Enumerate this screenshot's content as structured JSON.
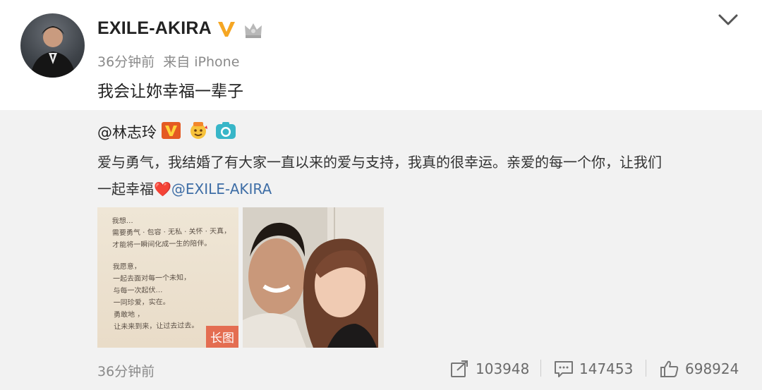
{
  "header": {
    "username": "EXILE-AKIRA",
    "time": "36分钟前",
    "source": "来自 iPhone",
    "post_text": "我会让妳幸福一辈子"
  },
  "repost": {
    "user": "@林志玲",
    "text_line1": "爱与勇气，我结婚了有大家一直以来的爱与支持，我真的很幸运。亲爱的每一个你，让我们",
    "text_line2_prefix": "一起幸福",
    "heart": "❤️",
    "mention": "@EXILE-AKIRA",
    "image1_tag": "长图",
    "letter_lines": [
      "我想…",
      "需要勇气 · 包容 · 无私 · 关怀 · 天真，",
      "才能将一瞬间化成一生的陪伴。",
      "我愿意，",
      "一起去面对每一个未知，",
      "与每一次起伏…",
      "一同珍爱，实在。",
      "勇敢地 ，",
      "让未来到来，让过去过去。"
    ],
    "time": "36分钟前",
    "stats": {
      "reposts": "103948",
      "comments": "147453",
      "likes": "698924"
    }
  },
  "colors": {
    "accent_v": "#f5a623",
    "mention": "#3f6ea6",
    "tag_bg": "#e36347"
  },
  "icons": [
    "avatar",
    "verified-v-icon",
    "crown-icon",
    "chevron-down-icon",
    "vip-v-icon",
    "emoji-icon",
    "camera-icon",
    "share-icon",
    "comment-icon",
    "like-icon"
  ]
}
